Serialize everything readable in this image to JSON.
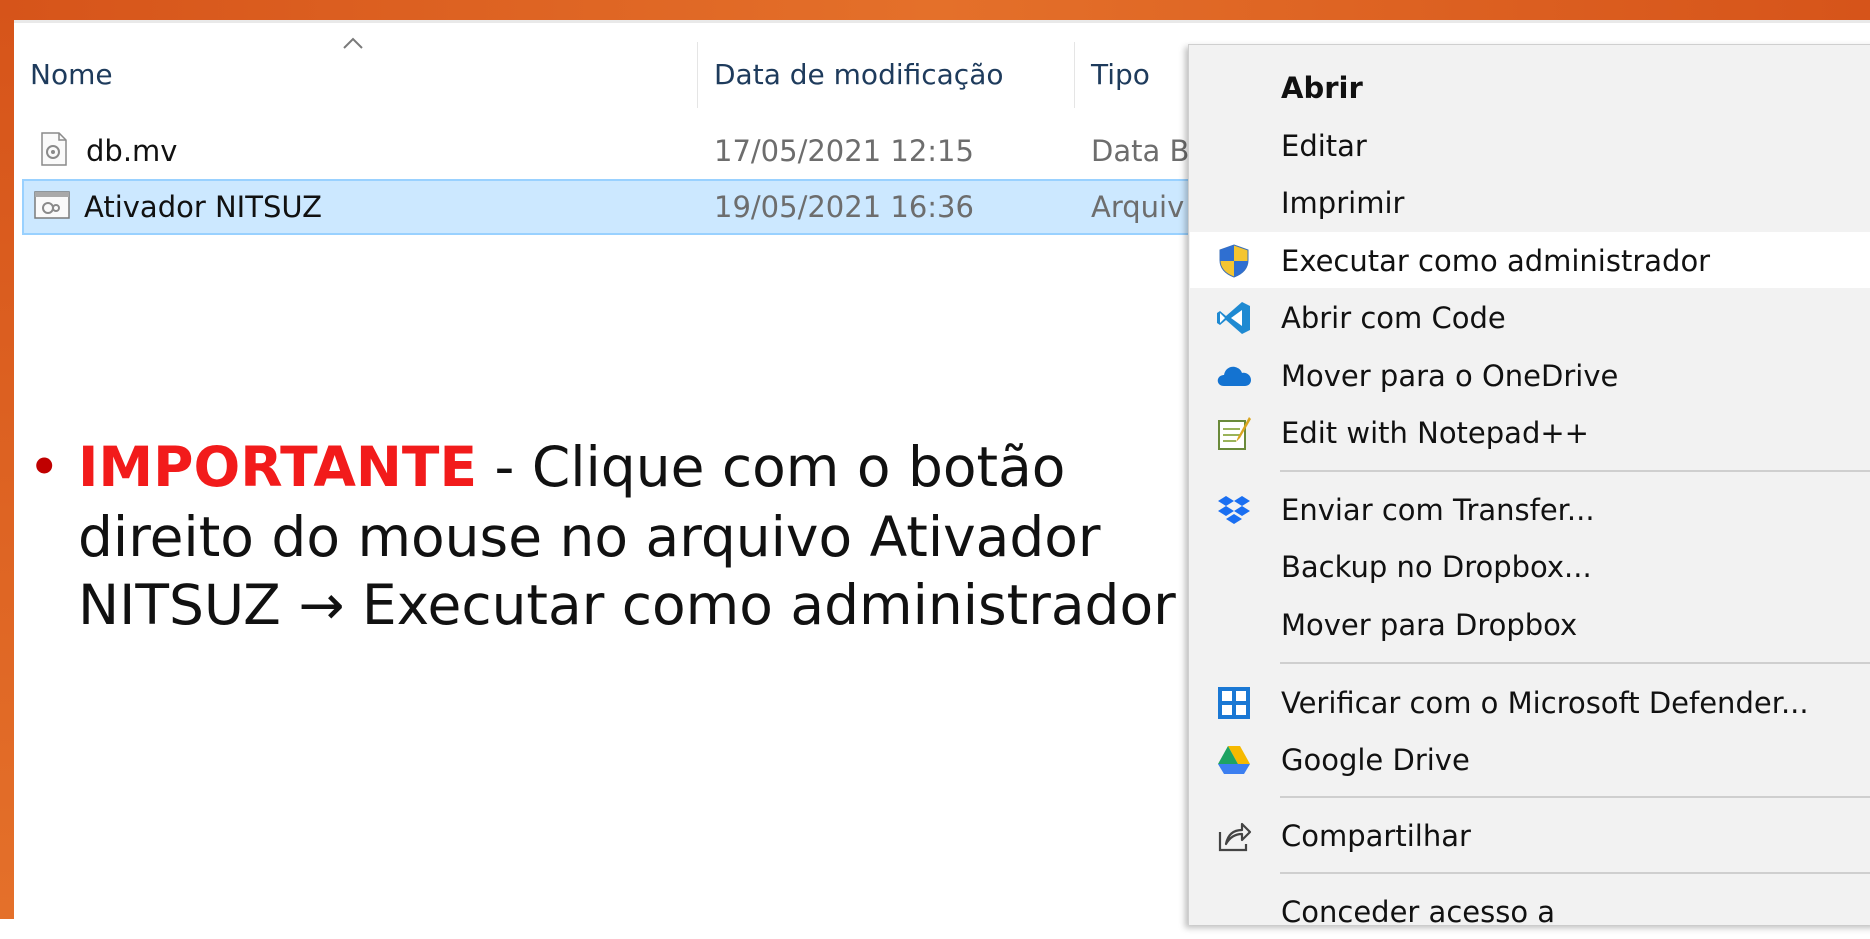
{
  "explorer": {
    "columns": {
      "name": "Nome",
      "modified": "Data de modificação",
      "type": "Tipo"
    },
    "files": [
      {
        "name": "db.mv",
        "modified": "17/05/2021 12:15",
        "type": "Data Ba"
      },
      {
        "name": "Ativador NITSUZ",
        "modified": "19/05/2021 16:36",
        "type": "Arquiv"
      }
    ]
  },
  "instruction": {
    "emphasis": "IMPORTANTE",
    "line1_rest": " - Clique com o botão",
    "line2": "direito do mouse no arquivo Ativador",
    "line3": "NITSUZ → Executar como administrador"
  },
  "context_menu": {
    "open": "Abrir",
    "edit": "Editar",
    "print": "Imprimir",
    "run_as_admin": "Executar como administrador",
    "open_with_code": "Abrir com Code",
    "move_onedrive": "Mover para o OneDrive",
    "edit_notepad": "Edit with Notepad++",
    "send_transfer": "Enviar com Transfer...",
    "backup_dropbox": "Backup no Dropbox...",
    "move_dropbox": "Mover para Dropbox",
    "scan_defender": "Verificar com o Microsoft Defender...",
    "google_drive": "Google Drive",
    "share": "Compartilhar",
    "grant_access": "Conceder acesso a"
  },
  "colors": {
    "frame": "#e4702a",
    "selection": "#cce8ff",
    "emphasis": "#f21b1b"
  },
  "icons": {
    "run_as_admin": "uac-shield-icon",
    "open_with_code": "vscode-icon",
    "move_onedrive": "onedrive-cloud-icon",
    "edit_notepad": "notepad-plus-plus-icon",
    "send_transfer": "dropbox-icon",
    "scan_defender": "defender-shield-icon",
    "google_drive": "google-drive-icon",
    "share": "share-icon"
  }
}
